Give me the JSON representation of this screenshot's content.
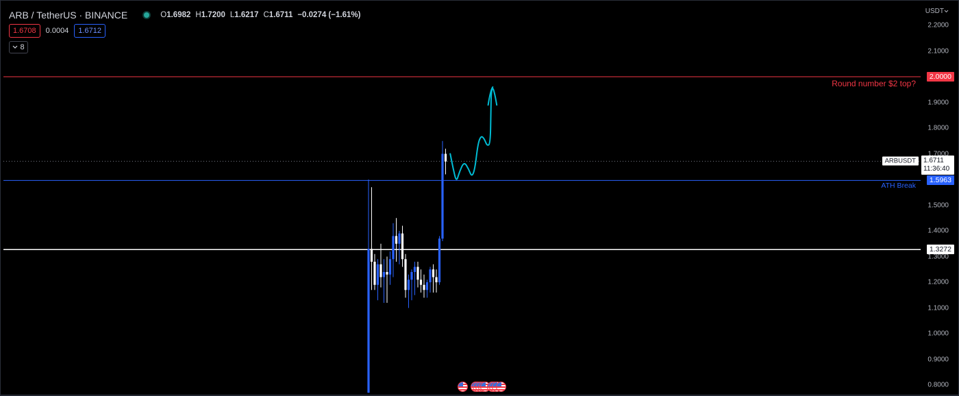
{
  "header": {
    "symbol": "ARB / TetherUS · BINANCE",
    "open_label": "O",
    "open": "1.6982",
    "high_label": "H",
    "high": "1.7200",
    "low_label": "L",
    "low": "1.6217",
    "close_label": "C",
    "close": "1.6711",
    "change": "−0.0274 (−1.61%)",
    "status_color": "#26a69a"
  },
  "trade": {
    "sell_price": "1.6708",
    "spread": "0.0004",
    "buy_price": "1.6712"
  },
  "indicators_toggle": {
    "count": "8",
    "icon": "chevron-down-icon"
  },
  "chart_data": {
    "type": "candlestick",
    "symbol": "ARB / TetherUS · BINANCE",
    "currency_label": "USDT",
    "y_ticks": [
      "2.2000",
      "2.1000",
      "2.0000",
      "1.9000",
      "1.8000",
      "1.7000",
      "1.6000",
      "1.5000",
      "1.4000",
      "1.3000",
      "1.2000",
      "1.1000",
      "1.0000",
      "0.9000",
      "0.8000"
    ],
    "ylim": [
      0.78,
      2.24
    ],
    "grid": false,
    "candles": [
      {
        "o": 0.77,
        "h": 1.6,
        "l": 0.77,
        "c": 1.33
      },
      {
        "o": 1.33,
        "h": 1.57,
        "l": 1.17,
        "c": 1.28
      },
      {
        "o": 1.28,
        "h": 1.31,
        "l": 1.17,
        "c": 1.19
      },
      {
        "o": 1.19,
        "h": 1.29,
        "l": 1.13,
        "c": 1.27
      },
      {
        "o": 1.27,
        "h": 1.35,
        "l": 1.18,
        "c": 1.22
      },
      {
        "o": 1.22,
        "h": 1.29,
        "l": 1.12,
        "c": 1.24
      },
      {
        "o": 1.24,
        "h": 1.3,
        "l": 1.12,
        "c": 1.23
      },
      {
        "o": 1.23,
        "h": 1.32,
        "l": 1.19,
        "c": 1.29
      },
      {
        "o": 1.29,
        "h": 1.43,
        "l": 1.22,
        "c": 1.38
      },
      {
        "o": 1.38,
        "h": 1.45,
        "l": 1.28,
        "c": 1.35
      },
      {
        "o": 1.35,
        "h": 1.4,
        "l": 1.27,
        "c": 1.39
      },
      {
        "o": 1.39,
        "h": 1.42,
        "l": 1.26,
        "c": 1.29
      },
      {
        "o": 1.29,
        "h": 1.31,
        "l": 1.14,
        "c": 1.17
      },
      {
        "o": 1.17,
        "h": 1.23,
        "l": 1.1,
        "c": 1.21
      },
      {
        "o": 1.21,
        "h": 1.25,
        "l": 1.13,
        "c": 1.24
      },
      {
        "o": 1.24,
        "h": 1.28,
        "l": 1.15,
        "c": 1.26
      },
      {
        "o": 1.26,
        "h": 1.28,
        "l": 1.18,
        "c": 1.21
      },
      {
        "o": 1.21,
        "h": 1.25,
        "l": 1.16,
        "c": 1.19
      },
      {
        "o": 1.19,
        "h": 1.23,
        "l": 1.14,
        "c": 1.17
      },
      {
        "o": 1.17,
        "h": 1.21,
        "l": 1.14,
        "c": 1.2
      },
      {
        "o": 1.2,
        "h": 1.26,
        "l": 1.16,
        "c": 1.25
      },
      {
        "o": 1.25,
        "h": 1.27,
        "l": 1.16,
        "c": 1.22
      },
      {
        "o": 1.22,
        "h": 1.25,
        "l": 1.16,
        "c": 1.2
      },
      {
        "o": 1.2,
        "h": 1.38,
        "l": 1.19,
        "c": 1.37
      },
      {
        "o": 1.37,
        "h": 1.75,
        "l": 1.36,
        "c": 1.7
      },
      {
        "o": 1.7,
        "h": 1.72,
        "l": 1.62,
        "c": 1.67
      }
    ],
    "horizontal_lines": [
      {
        "price": "2.0000",
        "color": "#f23645",
        "label": "Round number $2 top?"
      },
      {
        "price": "1.5963",
        "color": "#2962ff",
        "label": "ATH Break"
      },
      {
        "price": "1.3272",
        "color": "#ffffff",
        "label": ""
      }
    ],
    "last_price": {
      "price": "1.6711",
      "countdown": "11:36:40",
      "symbol_tag": "ARBUSDT"
    },
    "projection_path": [
      {
        "t": 26.5,
        "p": 1.7
      },
      {
        "t": 27.5,
        "p": 1.64
      },
      {
        "t": 28.5,
        "p": 1.59
      },
      {
        "t": 29.5,
        "p": 1.63
      },
      {
        "t": 31.0,
        "p": 1.67
      },
      {
        "t": 32.5,
        "p": 1.64
      },
      {
        "t": 33.5,
        "p": 1.61
      },
      {
        "t": 34.5,
        "p": 1.64
      },
      {
        "t": 35.5,
        "p": 1.74
      },
      {
        "t": 36.5,
        "p": 1.77
      },
      {
        "t": 37.5,
        "p": 1.76
      },
      {
        "t": 38.5,
        "p": 1.73
      },
      {
        "t": 39.5,
        "p": 1.74
      },
      {
        "t": 39.7,
        "p": 1.86
      },
      {
        "t": 39.8,
        "p": 1.94
      },
      {
        "t": 40.3,
        "p": 1.96
      },
      {
        "t": 41.0,
        "p": 1.93
      },
      {
        "t": 41.6,
        "p": 1.89
      }
    ],
    "projection_left": {
      "t": 38.8,
      "p": 1.89
    },
    "projection_color": "#00bcd4",
    "event_flags": [
      {
        "t": 30.5
      },
      {
        "t": 34.6
      },
      {
        "t": 35.4
      },
      {
        "t": 36.2
      },
      {
        "t": 37.0
      },
      {
        "t": 37.8
      },
      {
        "t": 39.9
      },
      {
        "t": 40.7
      },
      {
        "t": 41.5
      },
      {
        "t": 42.8
      }
    ],
    "colors": {
      "up": "#2962ff",
      "down": "#ffffff",
      "background": "#000000"
    }
  }
}
